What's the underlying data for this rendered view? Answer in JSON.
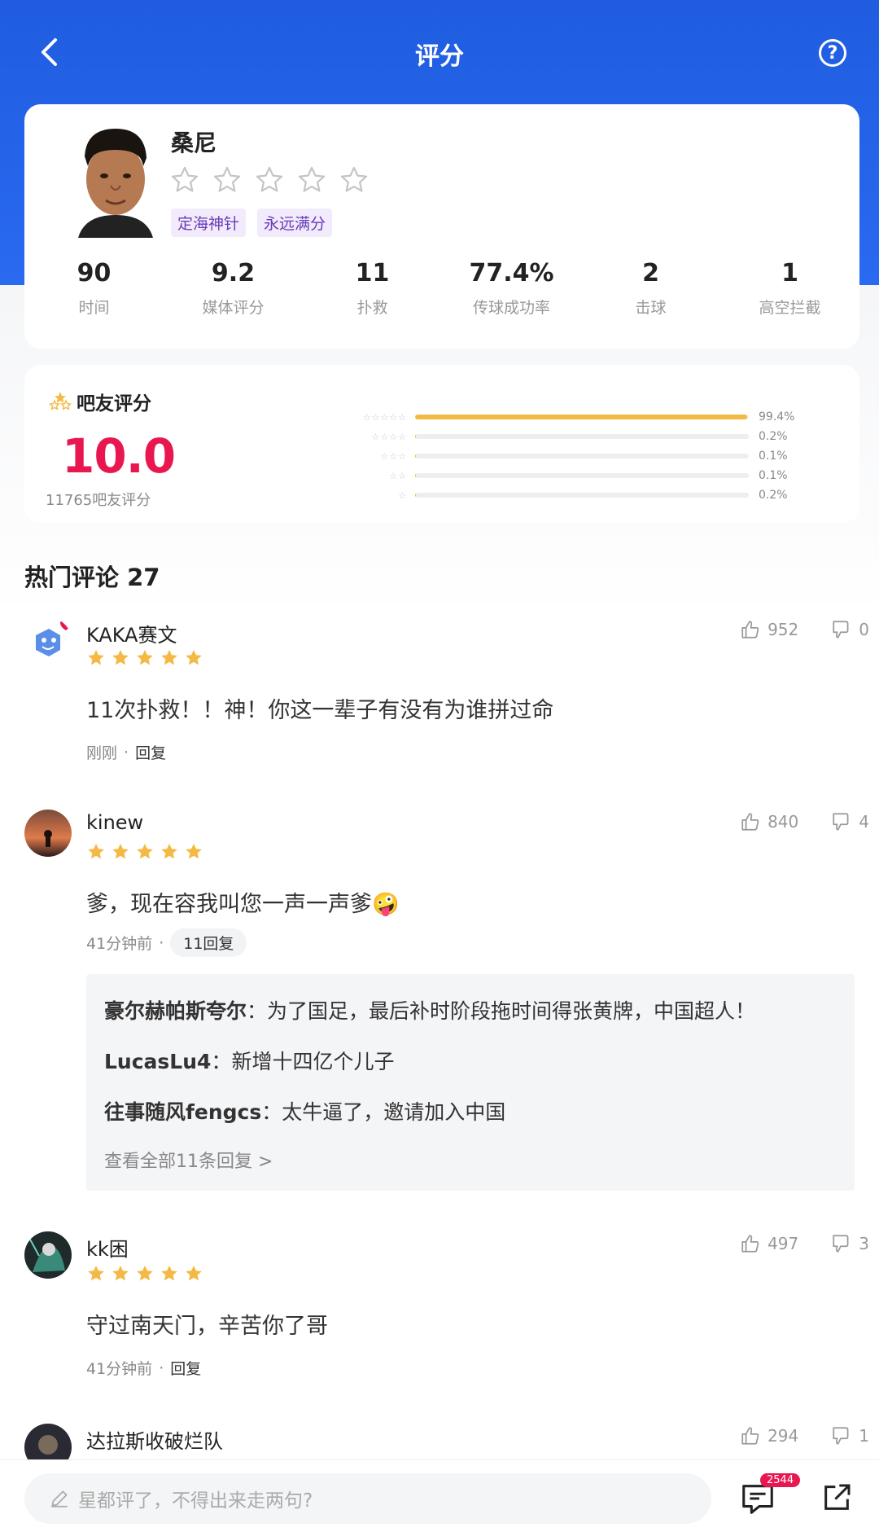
{
  "header": {
    "title": "评分"
  },
  "player": {
    "name": "桑尼",
    "tags": [
      "定海神针",
      "永远满分"
    ],
    "stats": [
      {
        "value": "90",
        "label": "时间"
      },
      {
        "value": "9.2",
        "label": "媒体评分"
      },
      {
        "value": "11",
        "label": "扑救"
      },
      {
        "value": "77.4%",
        "label": "传球成功率"
      },
      {
        "value": "2",
        "label": "击球"
      },
      {
        "value": "1",
        "label": "高空拦截"
      }
    ]
  },
  "fan_rating": {
    "title": "吧友评分",
    "score": "10.0",
    "count": "11765吧友评分",
    "distribution": [
      {
        "stars": 5,
        "percent_text": "99.4%",
        "fraction": 0.994
      },
      {
        "stars": 4,
        "percent_text": "0.2%",
        "fraction": 0.002
      },
      {
        "stars": 3,
        "percent_text": "0.1%",
        "fraction": 0.001
      },
      {
        "stars": 2,
        "percent_text": "0.1%",
        "fraction": 0.001
      },
      {
        "stars": 1,
        "percent_text": "0.2%",
        "fraction": 0.002
      }
    ]
  },
  "comments_section": {
    "title": "热门评论 27"
  },
  "comments": [
    {
      "user": "KAKA赛文",
      "text": "11次扑救！！神！你这一辈子有没有为谁拼过命",
      "time": "刚刚",
      "reply": "回复",
      "likes": "952",
      "dislikes": "0"
    },
    {
      "user": "kinew",
      "text": "爹，现在容我叫您一声一声爹🤪",
      "time": "41分钟前",
      "reply": "11回复",
      "likes": "840",
      "dislikes": "4",
      "replies": [
        {
          "user": "豪尔赫帕斯夸尔",
          "text": "为了国足，最后补时阶段拖时间得张黄牌，中国超人！"
        },
        {
          "user": "LucasLu4",
          "text": "新增十四亿个儿子"
        },
        {
          "user": "往事随风fengcs",
          "text": "太牛逼了，邀请加入中国"
        }
      ],
      "more": "查看全部11条回复 >"
    },
    {
      "user": "kk困",
      "text": "守过南天门，辛苦你了哥",
      "time": "41分钟前",
      "reply": "回复",
      "likes": "497",
      "dislikes": "3"
    },
    {
      "user": "达拉斯收破烂队",
      "likes": "294",
      "dislikes": "1"
    }
  ],
  "bottom": {
    "placeholder": "星都评了，不得出来走两句?",
    "badge": "2544"
  },
  "colors": {
    "header": "#1f5ce0",
    "score": "#e8174f",
    "star": "#f4b944",
    "tag_bg": "#f1ebfb",
    "tag_text": "#6a3ab8"
  },
  "icons": [
    "back-arrow-icon",
    "help-icon",
    "star-outline-icon",
    "star-filled-icon",
    "thumb-up-icon",
    "thumb-down-icon",
    "edit-icon",
    "comment-icon",
    "share-icon"
  ]
}
